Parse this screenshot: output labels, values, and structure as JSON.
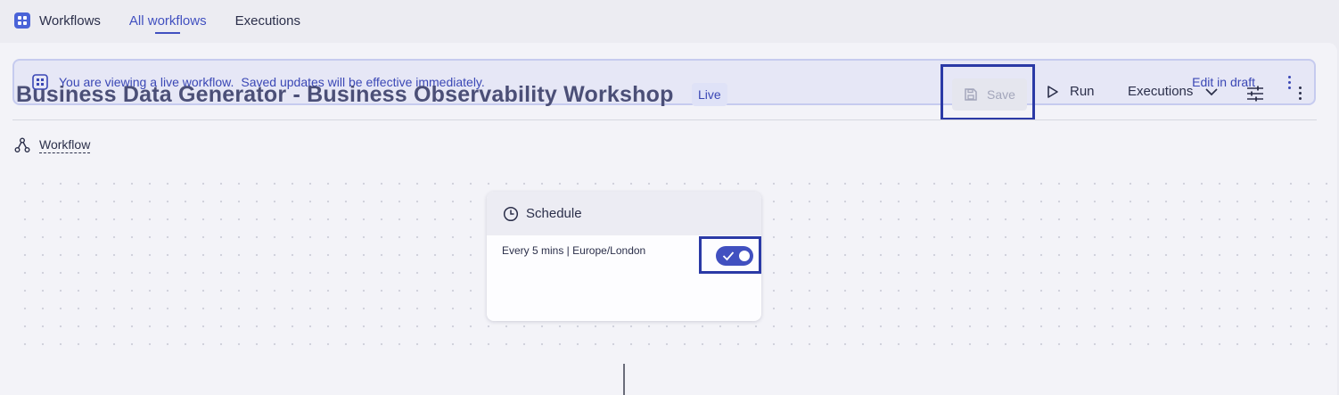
{
  "topnav": {
    "app_name": "Workflows",
    "tabs": [
      {
        "label": "All workflows",
        "active": true
      },
      {
        "label": "Executions",
        "active": false
      }
    ]
  },
  "banner": {
    "strong_text": "You are viewing a live workflow.",
    "text": "Saved updates will be effective immediately.",
    "edit_label": "Edit in draft"
  },
  "header": {
    "title": "Business Data Generator - Business Observability Workshop",
    "badge": "Live",
    "save_label": "Save",
    "run_label": "Run",
    "executions_label": "Executions"
  },
  "workflow_link": "Workflow",
  "node": {
    "title": "Schedule",
    "description": "Every 5 mins | Europe/London",
    "enabled": true
  },
  "colors": {
    "accent": "#4150c0",
    "banner_bg": "#e6e7f6",
    "highlight_frame": "#2b3aa6"
  }
}
